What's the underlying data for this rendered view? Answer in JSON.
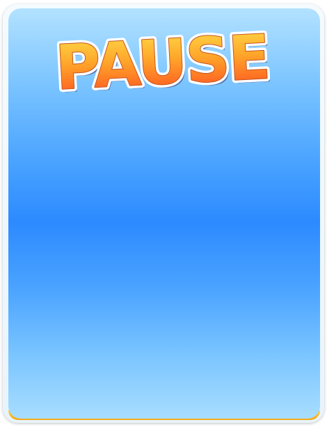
{
  "screen": {
    "title": "PAUSE"
  },
  "colors": {
    "panel_top": "#b3e2ff",
    "panel_mid": "#2d8aff",
    "panel_bottom": "#a8ddff",
    "bottom_trim": "#f3a817",
    "title_fill_top": "#ffd23a",
    "title_fill_bottom": "#ff4a1f",
    "title_outline": "#ffffff",
    "title_shadow": "#3a2a6a"
  }
}
